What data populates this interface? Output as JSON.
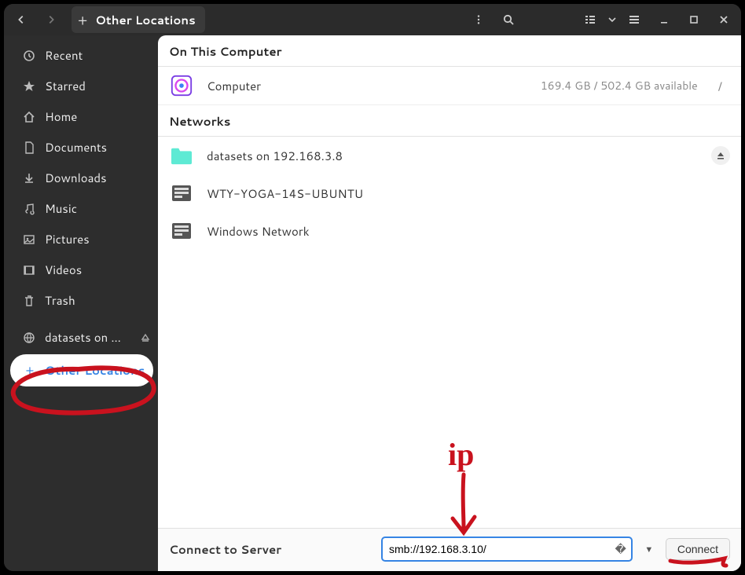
{
  "titlebar": {
    "location_label": "Other Locations"
  },
  "sidebar": {
    "items": [
      {
        "label": "Recent"
      },
      {
        "label": "Starred"
      },
      {
        "label": "Home"
      },
      {
        "label": "Documents"
      },
      {
        "label": "Downloads"
      },
      {
        "label": "Music"
      },
      {
        "label": "Pictures"
      },
      {
        "label": "Videos"
      },
      {
        "label": "Trash"
      },
      {
        "label": "datasets on …"
      },
      {
        "label": "Other Locations"
      }
    ]
  },
  "main": {
    "section_computer": "On This Computer",
    "computer": {
      "name": "Computer",
      "meta": "169.4 GB / 502.4 GB available",
      "mount": "/"
    },
    "section_networks": "Networks",
    "networks": [
      {
        "name": "datasets on 192.168.3.8"
      },
      {
        "name": "WTY-YOGA-14S-UBUNTU"
      },
      {
        "name": "Windows Network"
      }
    ],
    "connect": {
      "label": "Connect to Server",
      "value": "smb://192.168.3.10/",
      "button": "Connect"
    }
  },
  "annotation": {
    "text": "ip"
  }
}
